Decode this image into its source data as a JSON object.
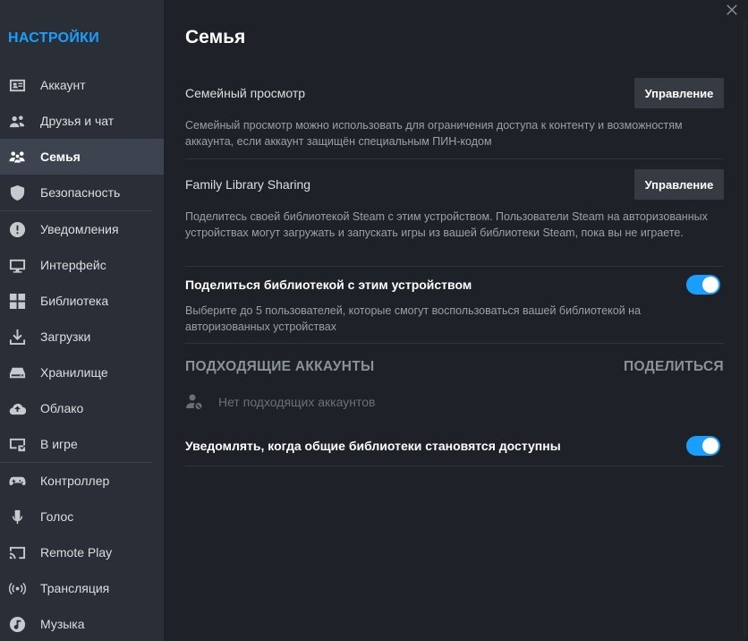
{
  "sidebar": {
    "title": "НАСТРОЙКИ",
    "items": [
      {
        "label": "Аккаунт",
        "icon": "account-card-icon",
        "active": false
      },
      {
        "label": "Друзья и чат",
        "icon": "friends-icon",
        "active": false
      },
      {
        "label": "Семья",
        "icon": "family-icon",
        "active": true
      },
      {
        "label": "Безопасность",
        "icon": "shield-icon",
        "active": false
      },
      {
        "label": "Уведомления",
        "icon": "alert-icon",
        "active": false
      },
      {
        "label": "Интерфейс",
        "icon": "monitor-icon",
        "active": false
      },
      {
        "label": "Библиотека",
        "icon": "grid-icon",
        "active": false
      },
      {
        "label": "Загрузки",
        "icon": "download-icon",
        "active": false
      },
      {
        "label": "Хранилище",
        "icon": "storage-icon",
        "active": false
      },
      {
        "label": "Облако",
        "icon": "cloud-icon",
        "active": false
      },
      {
        "label": "В игре",
        "icon": "ingame-icon",
        "active": false
      },
      {
        "label": "Контроллер",
        "icon": "gamepad-icon",
        "active": false
      },
      {
        "label": "Голос",
        "icon": "microphone-icon",
        "active": false
      },
      {
        "label": "Remote Play",
        "icon": "cast-icon",
        "active": false
      },
      {
        "label": "Трансляция",
        "icon": "broadcast-icon",
        "active": false
      },
      {
        "label": "Музыка",
        "icon": "music-icon",
        "active": false
      }
    ]
  },
  "main": {
    "title": "Семья",
    "family_view": {
      "label": "Семейный просмотр",
      "button": "Управление",
      "description": "Семейный просмотр можно использовать для ограничения доступа к контенту и возможностям аккаунта, если аккаунт защищён специальным ПИН-кодом"
    },
    "library_sharing": {
      "label": "Family Library Sharing",
      "button": "Управление",
      "description": "Поделитесь своей библиотекой Steam с этим устройством. Пользователи Steam на авторизованных устройствах могут загружать и запускать игры из вашей библиотеки Steam, пока вы не играете."
    },
    "share_toggle": {
      "label": "Поделиться библиотекой с этим устройством",
      "enabled": true,
      "description": "Выберите до 5 пользователей, которые смогут воспользоваться вашей библиотекой на авторизованных устройствах"
    },
    "accounts": {
      "col_accounts": "ПОДХОДЯЩИЕ АККАУНТЫ",
      "col_share": "ПОДЕЛИТЬСЯ",
      "empty": "Нет подходящих аккаунтов"
    },
    "notify_toggle": {
      "label": "Уведомлять, когда общие библиотеки становятся доступны",
      "enabled": true
    }
  },
  "colors": {
    "accent": "#1a9fff",
    "sidebar_bg": "#2a2e37",
    "main_bg": "#1e2128",
    "active_item": "#3d4450"
  }
}
